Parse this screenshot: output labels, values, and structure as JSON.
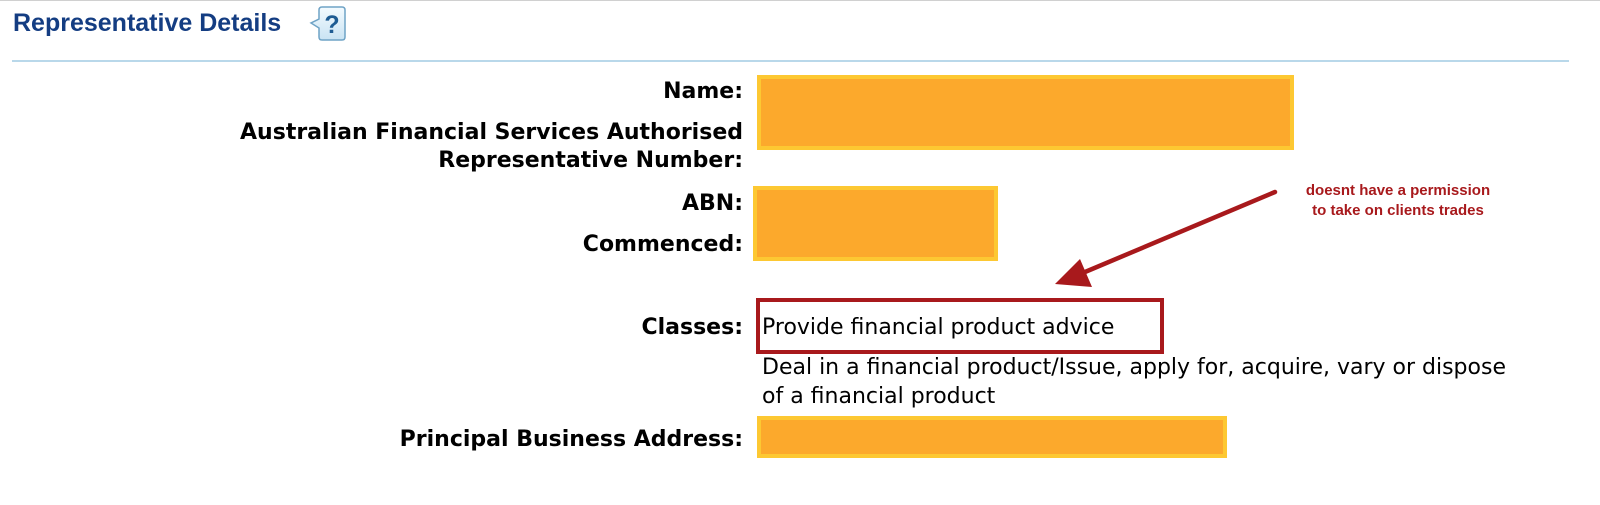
{
  "section": {
    "title": "Representative Details",
    "help_icon": "question-mark-icon"
  },
  "fields": {
    "name_label": "Name:",
    "afsar_label_line1": "Australian Financial Services Authorised",
    "afsar_label_line2": "Representative Number:",
    "abn_label": "ABN:",
    "commenced_label": "Commenced:",
    "classes_label": "Classes:",
    "address_label": "Principal Business Address:"
  },
  "classes": {
    "item1": "Provide financial product advice",
    "item2_line1": "Deal in a financial product/Issue, apply for, acquire, vary or dispose",
    "item2_line2": "of a financial product"
  },
  "annotation": {
    "line1": "doesnt have a permission",
    "line2": "to take on clients trades"
  },
  "colors": {
    "title": "#143d82",
    "redaction_fill": "#fca92c",
    "redaction_border": "#fdc832",
    "annotation_red": "#a8191c",
    "rule": "#b9d8ea"
  }
}
